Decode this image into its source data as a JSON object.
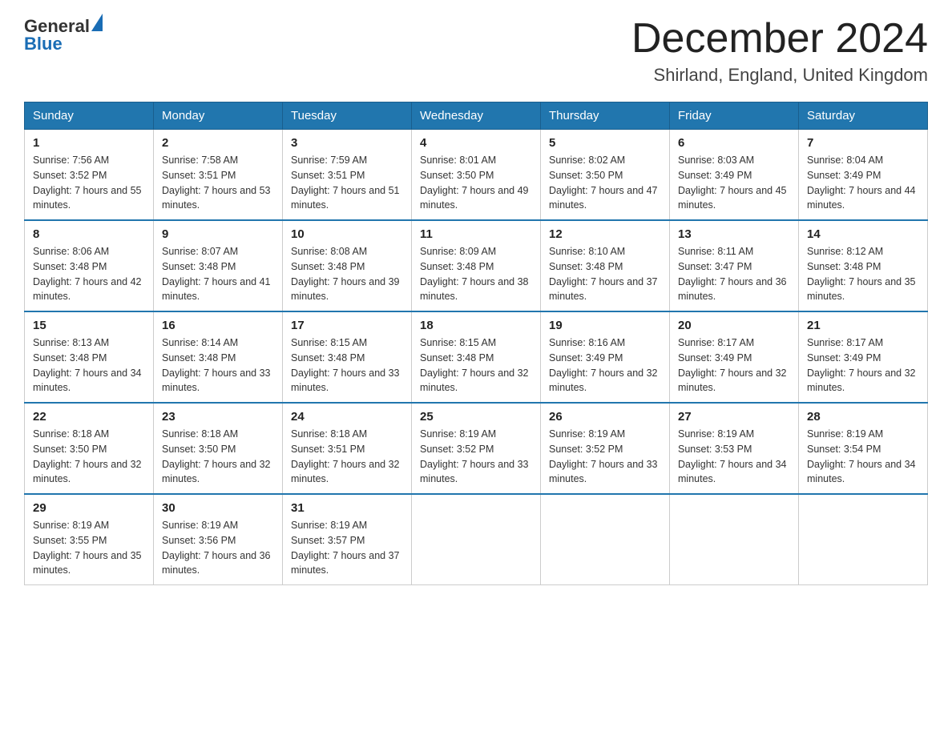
{
  "header": {
    "logo": {
      "general": "General",
      "blue": "Blue"
    },
    "title": "December 2024",
    "location": "Shirland, England, United Kingdom"
  },
  "weekdays": [
    "Sunday",
    "Monday",
    "Tuesday",
    "Wednesday",
    "Thursday",
    "Friday",
    "Saturday"
  ],
  "weeks": [
    [
      {
        "day": "1",
        "sunrise": "7:56 AM",
        "sunset": "3:52 PM",
        "daylight": "7 hours and 55 minutes."
      },
      {
        "day": "2",
        "sunrise": "7:58 AM",
        "sunset": "3:51 PM",
        "daylight": "7 hours and 53 minutes."
      },
      {
        "day": "3",
        "sunrise": "7:59 AM",
        "sunset": "3:51 PM",
        "daylight": "7 hours and 51 minutes."
      },
      {
        "day": "4",
        "sunrise": "8:01 AM",
        "sunset": "3:50 PM",
        "daylight": "7 hours and 49 minutes."
      },
      {
        "day": "5",
        "sunrise": "8:02 AM",
        "sunset": "3:50 PM",
        "daylight": "7 hours and 47 minutes."
      },
      {
        "day": "6",
        "sunrise": "8:03 AM",
        "sunset": "3:49 PM",
        "daylight": "7 hours and 45 minutes."
      },
      {
        "day": "7",
        "sunrise": "8:04 AM",
        "sunset": "3:49 PM",
        "daylight": "7 hours and 44 minutes."
      }
    ],
    [
      {
        "day": "8",
        "sunrise": "8:06 AM",
        "sunset": "3:48 PM",
        "daylight": "7 hours and 42 minutes."
      },
      {
        "day": "9",
        "sunrise": "8:07 AM",
        "sunset": "3:48 PM",
        "daylight": "7 hours and 41 minutes."
      },
      {
        "day": "10",
        "sunrise": "8:08 AM",
        "sunset": "3:48 PM",
        "daylight": "7 hours and 39 minutes."
      },
      {
        "day": "11",
        "sunrise": "8:09 AM",
        "sunset": "3:48 PM",
        "daylight": "7 hours and 38 minutes."
      },
      {
        "day": "12",
        "sunrise": "8:10 AM",
        "sunset": "3:48 PM",
        "daylight": "7 hours and 37 minutes."
      },
      {
        "day": "13",
        "sunrise": "8:11 AM",
        "sunset": "3:47 PM",
        "daylight": "7 hours and 36 minutes."
      },
      {
        "day": "14",
        "sunrise": "8:12 AM",
        "sunset": "3:48 PM",
        "daylight": "7 hours and 35 minutes."
      }
    ],
    [
      {
        "day": "15",
        "sunrise": "8:13 AM",
        "sunset": "3:48 PM",
        "daylight": "7 hours and 34 minutes."
      },
      {
        "day": "16",
        "sunrise": "8:14 AM",
        "sunset": "3:48 PM",
        "daylight": "7 hours and 33 minutes."
      },
      {
        "day": "17",
        "sunrise": "8:15 AM",
        "sunset": "3:48 PM",
        "daylight": "7 hours and 33 minutes."
      },
      {
        "day": "18",
        "sunrise": "8:15 AM",
        "sunset": "3:48 PM",
        "daylight": "7 hours and 32 minutes."
      },
      {
        "day": "19",
        "sunrise": "8:16 AM",
        "sunset": "3:49 PM",
        "daylight": "7 hours and 32 minutes."
      },
      {
        "day": "20",
        "sunrise": "8:17 AM",
        "sunset": "3:49 PM",
        "daylight": "7 hours and 32 minutes."
      },
      {
        "day": "21",
        "sunrise": "8:17 AM",
        "sunset": "3:49 PM",
        "daylight": "7 hours and 32 minutes."
      }
    ],
    [
      {
        "day": "22",
        "sunrise": "8:18 AM",
        "sunset": "3:50 PM",
        "daylight": "7 hours and 32 minutes."
      },
      {
        "day": "23",
        "sunrise": "8:18 AM",
        "sunset": "3:50 PM",
        "daylight": "7 hours and 32 minutes."
      },
      {
        "day": "24",
        "sunrise": "8:18 AM",
        "sunset": "3:51 PM",
        "daylight": "7 hours and 32 minutes."
      },
      {
        "day": "25",
        "sunrise": "8:19 AM",
        "sunset": "3:52 PM",
        "daylight": "7 hours and 33 minutes."
      },
      {
        "day": "26",
        "sunrise": "8:19 AM",
        "sunset": "3:52 PM",
        "daylight": "7 hours and 33 minutes."
      },
      {
        "day": "27",
        "sunrise": "8:19 AM",
        "sunset": "3:53 PM",
        "daylight": "7 hours and 34 minutes."
      },
      {
        "day": "28",
        "sunrise": "8:19 AM",
        "sunset": "3:54 PM",
        "daylight": "7 hours and 34 minutes."
      }
    ],
    [
      {
        "day": "29",
        "sunrise": "8:19 AM",
        "sunset": "3:55 PM",
        "daylight": "7 hours and 35 minutes."
      },
      {
        "day": "30",
        "sunrise": "8:19 AM",
        "sunset": "3:56 PM",
        "daylight": "7 hours and 36 minutes."
      },
      {
        "day": "31",
        "sunrise": "8:19 AM",
        "sunset": "3:57 PM",
        "daylight": "7 hours and 37 minutes."
      },
      null,
      null,
      null,
      null
    ]
  ]
}
